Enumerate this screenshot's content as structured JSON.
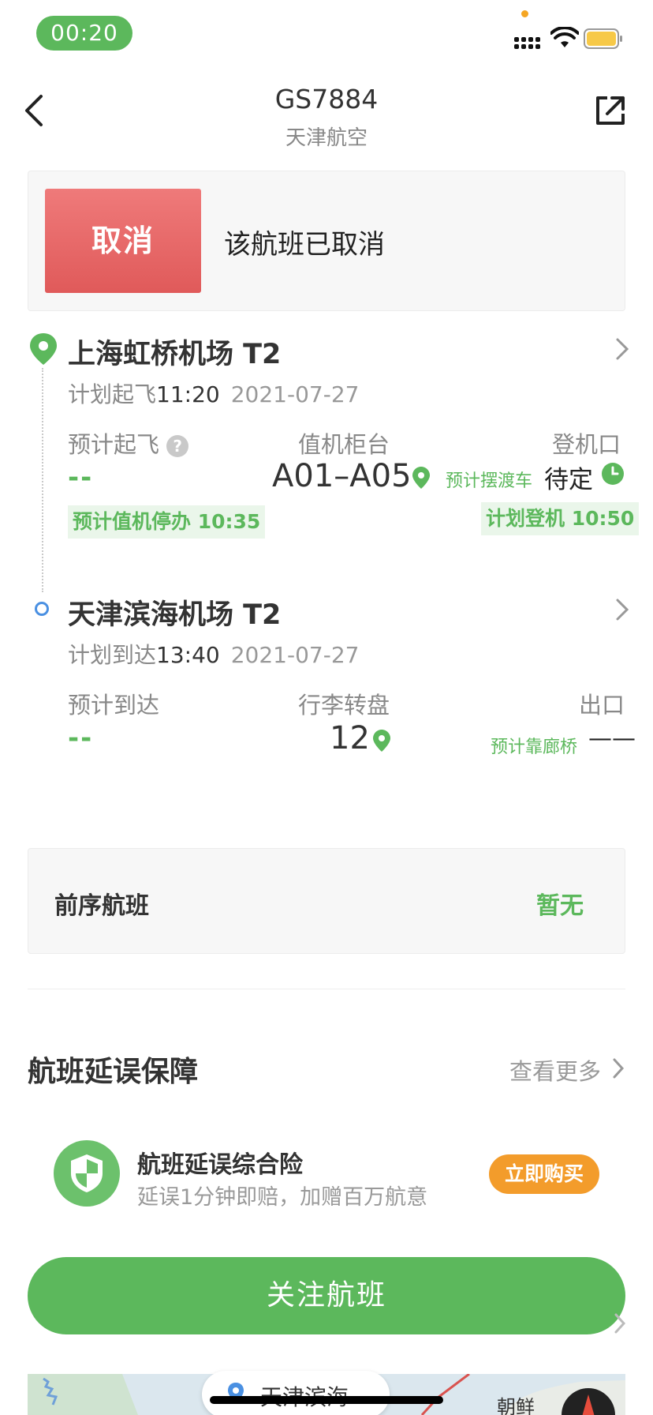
{
  "status_bar": {
    "time": "00:20"
  },
  "header": {
    "flight_no": "GS7884",
    "airline": "天津航空"
  },
  "status_banner": {
    "badge": "取消",
    "message": "该航班已取消"
  },
  "departure": {
    "airport": "上海虹桥机场 T2",
    "plan_label": "计划起飞",
    "plan_time": "11:20",
    "plan_date": "2021-07-27",
    "col1_label": "预计起飞",
    "col1_value": "--",
    "col1_tag": "预计值机停办 10:35",
    "col2_label": "值机柜台",
    "col2_value": "A01–A05",
    "col3_label": "登机口",
    "col3_note": "预计摆渡车",
    "col3_value": "待定",
    "col3_tag": "计划登机 10:50"
  },
  "arrival": {
    "airport": "天津滨海机场 T2",
    "plan_label": "计划到达",
    "plan_time": "13:40",
    "plan_date": "2021-07-27",
    "col1_label": "预计到达",
    "col1_value": "--",
    "col2_label": "行李转盘",
    "col2_value": "12",
    "col3_label": "出口",
    "col3_note": "预计靠廊桥",
    "col3_value": "——"
  },
  "previous_flight": {
    "label": "前序航班",
    "value": "暂无"
  },
  "delay_section": {
    "title": "航班延误保障",
    "more": "查看更多",
    "insurance_title": "航班延误综合险",
    "insurance_desc": "延误1分钟即赔，加赠百万航意",
    "buy_label": "立即购买"
  },
  "follow_button": "关注航班",
  "map": {
    "pill_text": "天津滨海",
    "region_label": "朝鲜"
  },
  "colors": {
    "green": "#5cb85c",
    "red": "#e05a5a",
    "orange": "#f39c2b",
    "blue": "#4a90e2"
  },
  "icons": [
    "back-icon",
    "share-icon",
    "location-pin-icon",
    "question-icon",
    "clock-icon",
    "chevron-right-icon",
    "shield-icon",
    "compass-icon",
    "wifi-icon",
    "battery-icon"
  ]
}
